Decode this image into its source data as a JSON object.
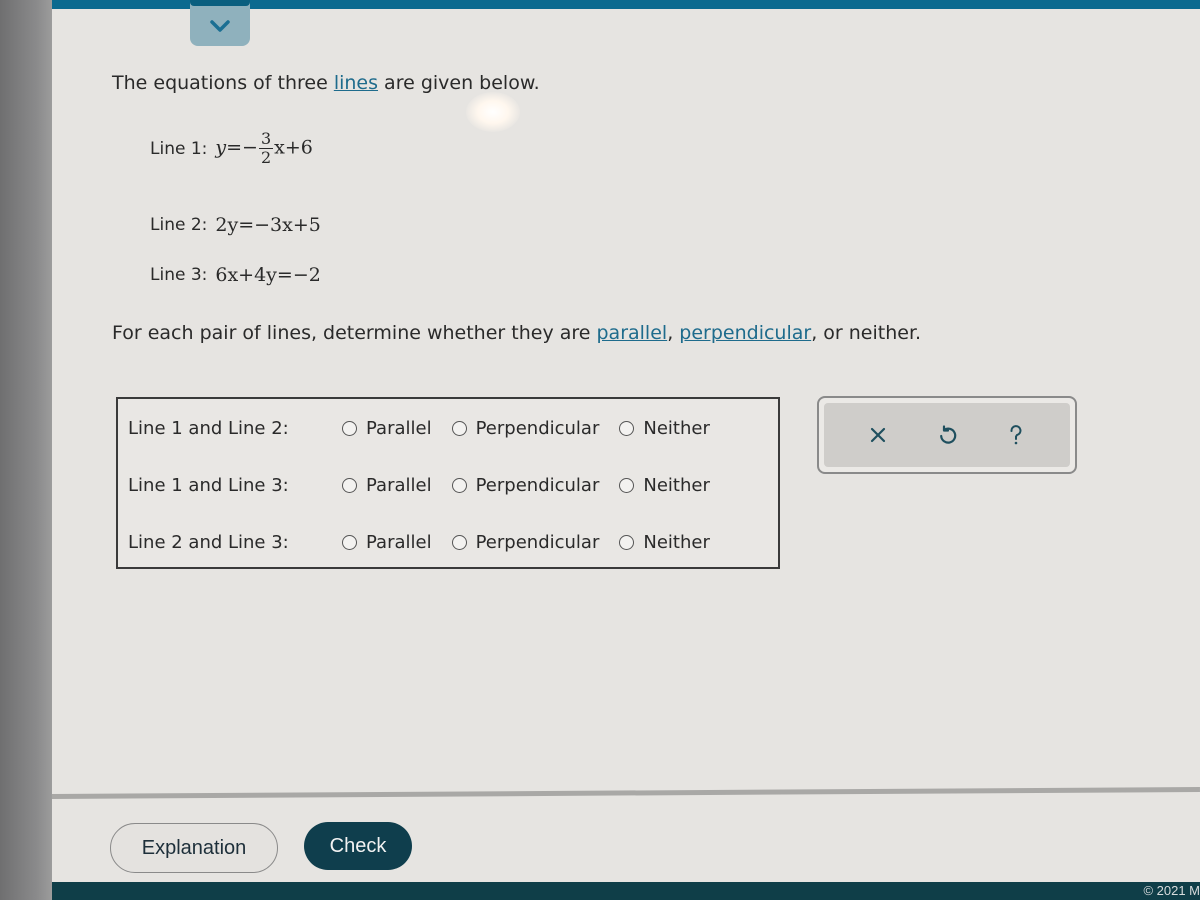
{
  "header": {
    "collapse_icon": "chevron-down-icon"
  },
  "intro": {
    "before": "The equations of three ",
    "link": "lines",
    "after": " are given below."
  },
  "equations": [
    {
      "label": "Line 1:",
      "lhs": "y",
      "rhs_sign": "=−",
      "frac_num": "3",
      "frac_den": "2",
      "rhs_rest": "x+6"
    },
    {
      "label": "Line 2:",
      "text": "2y=−3x+5"
    },
    {
      "label": "Line 3:",
      "text": "6x+4y=−2"
    }
  ],
  "instruction": {
    "before": "For each pair of lines, determine whether they are ",
    "link1": "parallel",
    "sep": ", ",
    "link2": "perpendicular",
    "after": ", or neither."
  },
  "answers": {
    "rows": [
      {
        "label": "Line 1 and Line 2:",
        "options": [
          "Parallel",
          "Perpendicular",
          "Neither"
        ],
        "selected": null
      },
      {
        "label": "Line 1 and Line 3:",
        "options": [
          "Parallel",
          "Perpendicular",
          "Neither"
        ],
        "selected": null
      },
      {
        "label": "Line 2 and Line 3:",
        "options": [
          "Parallel",
          "Perpendicular",
          "Neither"
        ],
        "selected": null
      }
    ]
  },
  "tools": {
    "clear_icon": "close-icon",
    "undo_icon": "undo-icon",
    "help_icon": "help-icon"
  },
  "buttons": {
    "explanation": "Explanation",
    "check": "Check"
  },
  "footer": {
    "copyright": "© 2021 M"
  },
  "colors": {
    "accent_link": "#1e6b8c",
    "top_bar": "#0b6a8f",
    "check_button": "#0f3e4d",
    "footer": "#0f3e48"
  }
}
